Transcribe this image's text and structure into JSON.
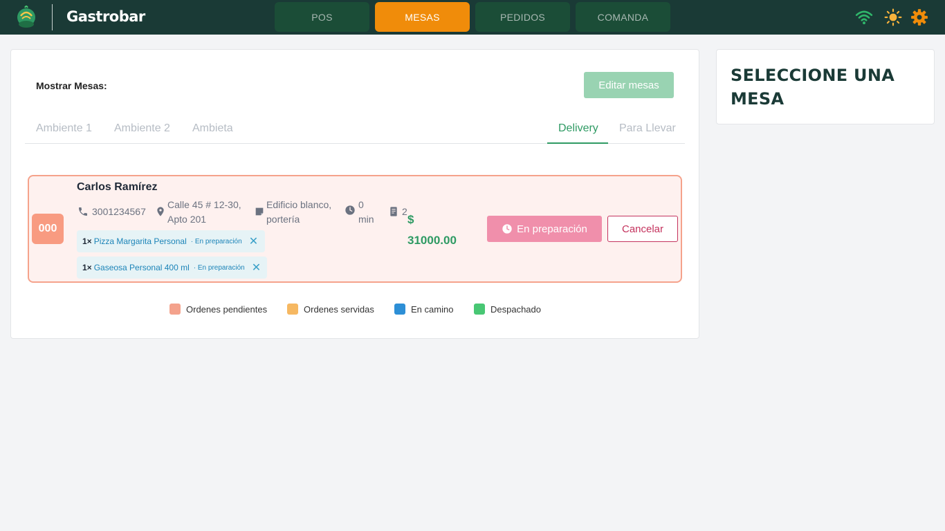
{
  "app": {
    "title": "Gastrobar"
  },
  "nav": [
    {
      "label": "POS",
      "active": false
    },
    {
      "label": "MESAS",
      "active": true
    },
    {
      "label": "PEDIDOS",
      "active": false
    },
    {
      "label": "COMANDA",
      "active": false
    }
  ],
  "topbar_icons": [
    "wifi-icon",
    "sun-icon",
    "gear-icon"
  ],
  "main": {
    "show_label": "Mostrar Mesas:",
    "edit_button": "Editar mesas",
    "tabs_left": [
      "Ambiente 1",
      "Ambiente 2",
      "Ambieta"
    ],
    "tabs_right": [
      "Delivery",
      "Para Llevar"
    ],
    "active_tab": "Delivery"
  },
  "order": {
    "badge": "000",
    "customer": "Carlos Ramírez",
    "phone": "3001234567",
    "address_line1": "Calle 45 # 12-30,",
    "address_line2": "Apto 201",
    "note_line1": "Edificio blanco,",
    "note_line2": "portería",
    "time_value": "0",
    "time_unit": "min",
    "count": "2",
    "currency": "$",
    "total": "31000.00",
    "items": [
      {
        "qty": "1×",
        "name": "Pizza Margarita Personal",
        "status": "· En preparación"
      },
      {
        "qty": "1×",
        "name": "Gaseosa Personal 400 ml",
        "status": "· En preparación"
      }
    ],
    "status_button": "En preparación",
    "cancel_button": "Cancelar"
  },
  "legend": [
    {
      "label": "Ordenes pendientes",
      "color": "#f4a28c"
    },
    {
      "label": "Ordenes servidas",
      "color": "#f6b862"
    },
    {
      "label": "En camino",
      "color": "#2d8fd6"
    },
    {
      "label": "Despachado",
      "color": "#48c774"
    }
  ],
  "side": {
    "title": "SELECCIONE UNA MESA"
  },
  "colors": {
    "topbar": "#1a3a36",
    "accent": "#f08c0a",
    "green": "#2e9a63"
  }
}
